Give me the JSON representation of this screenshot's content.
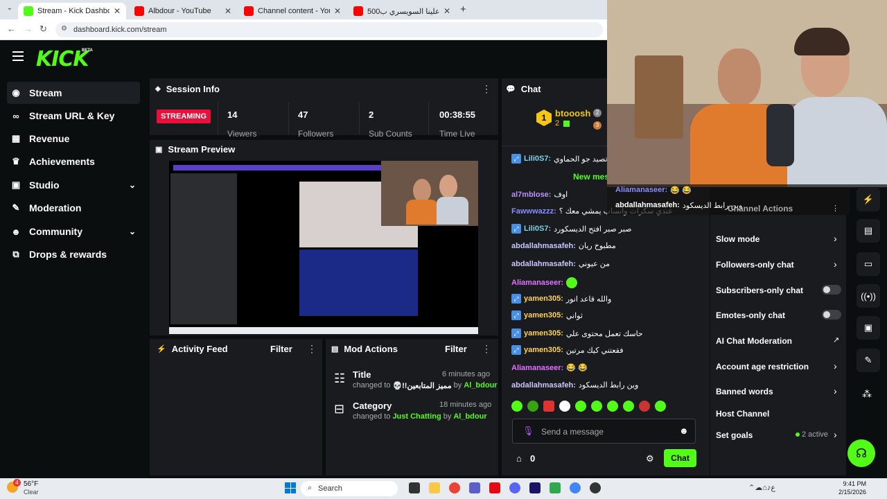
{
  "browser": {
    "tabs": [
      {
        "title": "Stream - Kick Dashboard",
        "color": "#53fc18"
      },
      {
        "title": "Albdour - YouTube",
        "color": "#ff0000"
      },
      {
        "title": "Channel content - YouTube Stu",
        "color": "#ff0000"
      },
      {
        "title": "كيف نصب علينا السويسري ب500$",
        "color": "#ff0000"
      }
    ],
    "new_tab": "+",
    "url": "dashboard.kick.com/stream"
  },
  "header": {
    "logo": "KICK",
    "beta": "BETA"
  },
  "sidebar": {
    "items": [
      {
        "label": "Stream",
        "icon": "broadcast-icon",
        "glyph": "◉"
      },
      {
        "label": "Stream URL & Key",
        "icon": "link-icon",
        "glyph": "🔗"
      },
      {
        "label": "Revenue",
        "icon": "bank-icon",
        "glyph": "▦"
      },
      {
        "label": "Achievements",
        "icon": "trophy-icon",
        "glyph": "🏆"
      },
      {
        "label": "Studio",
        "icon": "studio-icon",
        "glyph": "▣"
      },
      {
        "label": "Moderation",
        "icon": "wrench-icon",
        "glyph": "🔧"
      },
      {
        "label": "Community",
        "icon": "people-icon",
        "glyph": "👥"
      },
      {
        "label": "Drops & rewards",
        "icon": "gift-icon",
        "glyph": "⧉"
      }
    ]
  },
  "session": {
    "title": "Session Info",
    "status": "STREAMING",
    "stats": [
      {
        "value": "14",
        "label": "Viewers"
      },
      {
        "value": "47",
        "label": "Followers"
      },
      {
        "value": "2",
        "label": "Sub Counts"
      },
      {
        "value": "00:38:55",
        "label": "Time Live"
      }
    ]
  },
  "preview": {
    "title": "Stream Preview"
  },
  "activity": {
    "title": "Activity Feed",
    "filter": "Filter"
  },
  "mod_actions": {
    "title": "Mod Actions",
    "filter": "Filter",
    "items": [
      {
        "heading": "Title",
        "time": "6 minutes ago",
        "changed_to": "changed to",
        "value": "💀!!مميز المتابعين",
        "by": "by",
        "user": "Al_bdour"
      },
      {
        "heading": "Category",
        "time": "18 minutes ago",
        "changed_to": "changed to",
        "value": "Just Chatting",
        "by": "by",
        "user": "Al_bdour"
      }
    ]
  },
  "chat": {
    "title": "Chat",
    "top_user": {
      "name": "btooosh",
      "rank": "1",
      "count1": "2",
      "count2": "3"
    },
    "new_messages": "New mes",
    "messages": [
      {
        "user": "Lili0S7",
        "text": "تصيد جو الحماوي",
        "color": "#7fd1e8",
        "badge": true
      },
      {
        "user": "al7mblose",
        "text": "اوف",
        "color": "#b892ff",
        "badge": false
      },
      {
        "user": "Fawwwazzz",
        "text": "عندي سكرات وانساب يمشي معك ؟",
        "color": "#8a8cff",
        "badge": false
      },
      {
        "user": "Lili0S7",
        "text": "صبر صبر افتح الديسكورد",
        "color": "#7fd1e8",
        "badge": true
      },
      {
        "user": "abdallahmasafeh",
        "text": "مطبوخ ريان",
        "color": "#c8c8ff",
        "badge": false
      },
      {
        "user": "abdallahmasafeh",
        "text": "من عيوني",
        "color": "#c8c8ff",
        "badge": false
      },
      {
        "user": "Aliamanaseer",
        "text": "",
        "color": "#e272ff",
        "badge": false,
        "emote": true
      },
      {
        "user": "yamen305",
        "text": "والله قاعد انور",
        "color": "#ffd35c",
        "badge": true
      },
      {
        "user": "yamen305",
        "text": "ثواني",
        "color": "#ffd35c",
        "badge": true
      },
      {
        "user": "yamen305",
        "text": "حاسك تعمل محتوى علي",
        "color": "#ffd35c",
        "badge": true
      },
      {
        "user": "yamen305",
        "text": "فقعتني كيك مرتين",
        "color": "#ffd35c",
        "badge": true
      },
      {
        "user": "Aliamanaseer",
        "text": "😂 😂",
        "color": "#e272ff",
        "badge": false
      },
      {
        "user": "abdallahmasafeh",
        "text": "وين رابط الديسكود",
        "color": "#c8c8ff",
        "badge": false
      }
    ],
    "input_placeholder": "Send a message",
    "points": "0",
    "send": "Chat"
  },
  "overlay": {
    "line1_user": "Aliamanaseer:",
    "line1_text": "😂 😂",
    "line2_user": "abdallahmasafeh:",
    "line2_text": "وين رابط الديسكود"
  },
  "channel_actions": {
    "title": "Channel Actions",
    "items": [
      {
        "label": "Slow mode",
        "control": "chevron"
      },
      {
        "label": "Followers-only chat",
        "control": "chevron"
      },
      {
        "label": "Subscribers-only chat",
        "control": "toggle"
      },
      {
        "label": "Emotes-only chat",
        "control": "toggle"
      },
      {
        "label": "AI Chat Moderation",
        "control": "external"
      },
      {
        "label": "Account age restriction",
        "control": "chevron"
      },
      {
        "label": "Banned words",
        "control": "chevron"
      },
      {
        "label": "Host Channel",
        "control": "none"
      },
      {
        "label": "Set goals",
        "control": "goals"
      }
    ],
    "goals_active": "2 active"
  },
  "taskbar": {
    "weather_temp": "56°F",
    "weather_desc": "Clear",
    "search": "Search",
    "time": "9:41 PM",
    "date": "2/15/2026",
    "notification_count": "4"
  },
  "colors": {
    "accent": "#53fc18",
    "streaming": "#e9113c",
    "panel": "#191b1f"
  }
}
